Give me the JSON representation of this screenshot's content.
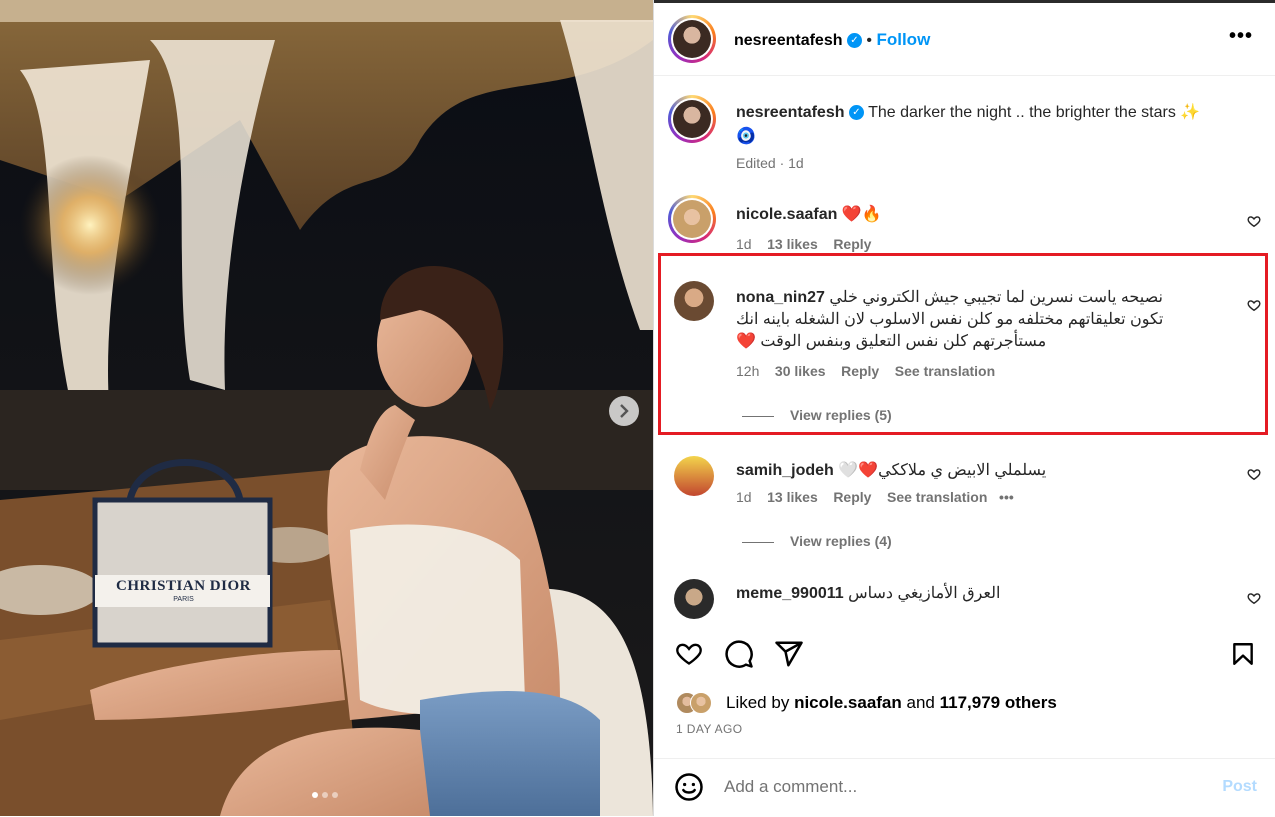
{
  "post": {
    "username": "nesreentafesh",
    "follow_label": "Follow",
    "dot": "•",
    "more": "•••",
    "caption": {
      "username": "nesreentafesh",
      "text": "The darker the night .. the brighter the stars ✨",
      "emoji_line": "🧿",
      "meta": "Edited · 1d"
    }
  },
  "photo": {
    "bag_text": "CHRISTIAN DIOR",
    "bag_sub": "PARIS",
    "next_icon": "chevron-right-icon"
  },
  "comments": [
    {
      "username": "nicole.saafan",
      "text": "❤️🔥",
      "time": "1d",
      "likes": "13 likes",
      "reply": "Reply"
    },
    {
      "username": "nona_nin27",
      "text_lines": [
        "نصيحه ياست نسرين لما تجيبي جيش الكتروني خلي",
        "تكون تعليقاتهم مختلفه مو كلن نفس الاسلوب لان الشغله باينه انك",
        "مستأجرتهم كلن نفس التعليق وبنفس الوقت ❤️"
      ],
      "time": "12h",
      "likes": "30 likes",
      "reply": "Reply",
      "translate": "See translation",
      "view_replies": "View replies (5)"
    },
    {
      "username": "samih_jodeh",
      "text": "يسلملي الابيض ي ملاككي❤️🤍",
      "time": "1d",
      "likes": "13 likes",
      "reply": "Reply",
      "translate": "See translation",
      "more": "•••",
      "view_replies": "View replies (4)"
    },
    {
      "username": "meme_990011",
      "text": "العرق الأمازيغي دساس"
    }
  ],
  "likes": {
    "prefix": "Liked by",
    "user": "nicole.saafan",
    "middle": "and",
    "count": "117,979 others"
  },
  "date": "1 DAY AGO",
  "add_comment": {
    "placeholder": "Add a comment...",
    "post_label": "Post"
  },
  "colors": {
    "accent": "#0095f6",
    "highlight": "#e41b23",
    "heart": "#ed4956"
  }
}
